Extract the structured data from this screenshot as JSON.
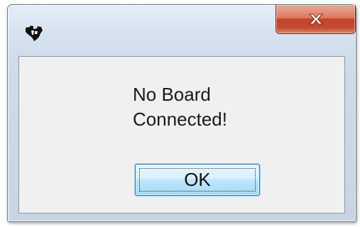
{
  "dialog": {
    "app_icon": "ti-logo-icon",
    "close_icon": "close-icon",
    "message_line1": "No Board",
    "message_line2": "Connected!",
    "ok_label": "OK"
  },
  "colors": {
    "close_button": "#c44a32",
    "ok_button_border": "#3c7fb1",
    "client_background": "#f0f0f0"
  }
}
